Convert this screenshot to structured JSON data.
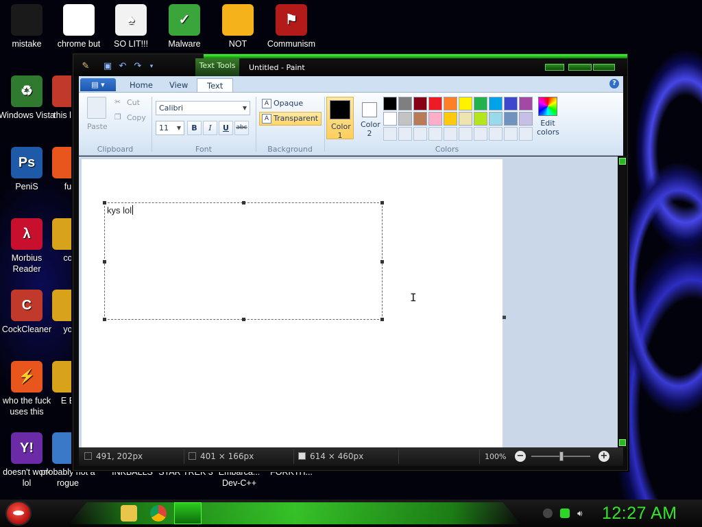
{
  "desktop": {
    "icons": [
      {
        "label": "mistake",
        "glyph": "",
        "color": "#1a1a1a"
      },
      {
        "label": "chrome but nor",
        "glyph": "",
        "color": "#ffffff"
      },
      {
        "label": "SO LIT!!!",
        "glyph": "♠",
        "color": "#f2f2f2"
      },
      {
        "label": "Malware",
        "glyph": "✓",
        "color": "#3aa53a"
      },
      {
        "label": "NOT",
        "glyph": "",
        "color": "#f5b21b"
      },
      {
        "label": "Communism",
        "glyph": "⚑",
        "color": "#b31b1b"
      },
      {
        "label": "Windows Vista",
        "glyph": "♻",
        "color": "#2f7a2f"
      },
      {
        "label": "PeniS",
        "glyph": "Ps",
        "color": "#1e5aa8"
      },
      {
        "label": "Morbius Reader",
        "glyph": "λ",
        "color": "#c8102e"
      },
      {
        "label": "CockCleaner",
        "glyph": "C",
        "color": "#c0392b"
      },
      {
        "label": "who the fuck uses this",
        "glyph": "⚡",
        "color": "#e8561e"
      },
      {
        "label": "doesn't work lol",
        "glyph": "Y!",
        "color": "#6b2aa6"
      },
      {
        "label": "this like",
        "glyph": "",
        "color": "#c0392b"
      },
      {
        "label": "fu",
        "glyph": "",
        "color": "#e8561e"
      },
      {
        "label": "co",
        "glyph": "",
        "color": "#d9a21b"
      },
      {
        "label": "yo",
        "glyph": "",
        "color": "#d9a21b"
      },
      {
        "label": "E E",
        "glyph": "",
        "color": "#d9a21b"
      },
      {
        "label": "probably not a rogue",
        "glyph": "",
        "color": "#3a78c8"
      },
      {
        "label": "INKBALLS",
        "glyph": "",
        "color": "#000000"
      },
      {
        "label": "STAR TREK 3",
        "glyph": "",
        "color": "#000000"
      },
      {
        "label": "Embarca... Dev-C++",
        "glyph": "",
        "color": "#000000"
      },
      {
        "label": "FORKTH...",
        "glyph": "",
        "color": "#000000"
      }
    ]
  },
  "paint": {
    "title": "Untitled - Paint",
    "context_tab": "Text Tools",
    "menu_button": "▤ ▾",
    "tabs": [
      "Home",
      "View",
      "Text"
    ],
    "active_tab": "Text",
    "clipboard": {
      "paste": "Paste",
      "cut": "Cut",
      "copy": "Copy",
      "group": "Clipboard"
    },
    "font": {
      "family": "Calibri",
      "size": "11",
      "group": "Font",
      "bold": "B",
      "italic": "I",
      "underline": "U",
      "strike": "abc"
    },
    "background": {
      "opaque": "Opaque",
      "transparent": "Transparent",
      "group": "Background",
      "selected": "Transparent"
    },
    "colors": {
      "color1_label": "Color 1",
      "color1": "#000000",
      "color2_label": "Color 2",
      "color2": "#ffffff",
      "group": "Colors",
      "edit": "Edit colors",
      "palette_row1": [
        "#000000",
        "#7f7f7f",
        "#880015",
        "#ed1c24",
        "#ff7f27",
        "#fff200",
        "#22b14c",
        "#00a2e8",
        "#3f48cc",
        "#a349a4"
      ],
      "palette_row2": [
        "#ffffff",
        "#c3c3c3",
        "#b97a57",
        "#ffaec9",
        "#ffc90e",
        "#efe4b0",
        "#b5e61d",
        "#99d9ea",
        "#7092be",
        "#c8bfe7"
      ]
    },
    "canvas_text": "kys lol",
    "status": {
      "cursor": "491, 202px",
      "selection": "401 × 166px",
      "size": "614 × 460px",
      "zoom": "100%"
    }
  },
  "taskbar": {
    "clock": "12:27 AM"
  }
}
